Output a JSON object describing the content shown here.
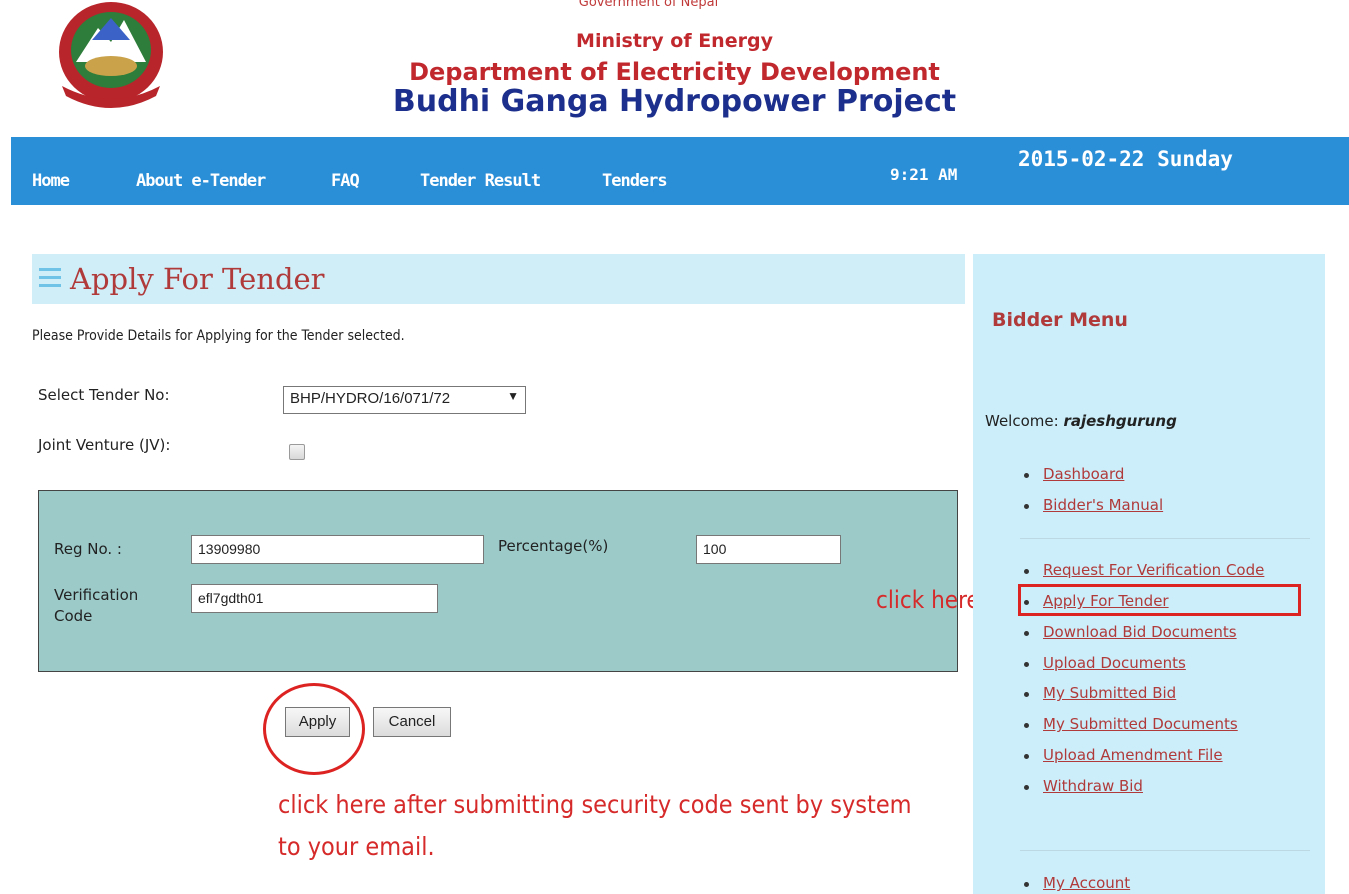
{
  "header": {
    "government": "Government of Nepal",
    "ministry": "Ministry of Energy",
    "department": "Department of Electricity Development",
    "project": "Budhi Ganga Hydropower Project"
  },
  "nav": {
    "items": [
      "Home",
      "About e-Tender",
      "FAQ",
      "Tender Result",
      "Tenders"
    ],
    "time": "9:21 AM",
    "date": "2015-02-22 Sunday"
  },
  "main": {
    "title": "Apply For Tender",
    "instructions": "Please Provide Details for Applying for the Tender selected.",
    "select_tender_label": "Select Tender No:",
    "select_tender_value": "BHP/HYDRO/16/071/72",
    "jv_label": "Joint Venture (JV):",
    "jv_checked": false,
    "reg_label": "Reg No. :",
    "reg_value": "13909980",
    "percentage_label": "Percentage(%)",
    "percentage_value": "100",
    "verification_label": "Verification Code",
    "verification_value": "efl7gdth01",
    "apply_label": "Apply",
    "cancel_label": "Cancel",
    "apply_note": "click here after submitting security code sent by system to your email.",
    "side_note": "click here"
  },
  "sidebar": {
    "title": "Bidder Menu",
    "welcome_prefix": "Welcome:",
    "username": "rajeshgurung",
    "group1": [
      "Dashboard",
      "Bidder's Manual"
    ],
    "group2": [
      "Request For Verification Code",
      "Apply For Tender",
      "Download Bid Documents",
      "Upload Documents",
      "My Submitted Bid",
      "My Submitted Documents",
      "Upload Amendment File",
      "Withdraw Bid"
    ],
    "group3": [
      "My Account"
    ]
  },
  "colors": {
    "nav_blue": "#2b8fd8",
    "title_red": "#b03a3a",
    "project_blue": "#1c2f8c",
    "panel_teal": "#9bcac9",
    "sidebar_bg": "#cbeefa",
    "annotation_red": "#d22"
  }
}
